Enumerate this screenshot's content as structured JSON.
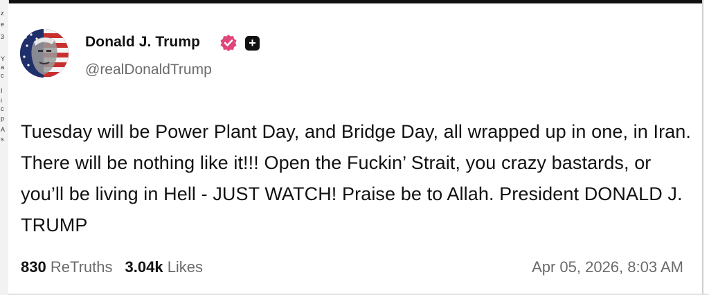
{
  "background_strip_text": [
    "z",
    "e",
    "3",
    "Y",
    "a",
    "c",
    "I",
    "i",
    "c",
    "p",
    "A",
    "s"
  ],
  "post": {
    "author": {
      "display_name": "Donald J. Trump",
      "handle": "@realDonaldTrump",
      "verified_icon": "verified-badge-icon",
      "plus_icon": "plus-icon",
      "plus_glyph": "+"
    },
    "text": "Tuesday will be Power Plant Day, and Bridge Day, all wrapped up in one, in Iran. There will be nothing like it!!! Open the Fuckin’ Strait, you crazy bastards, or you’ll be living in Hell - JUST WATCH! Praise be to Allah. President DONALD J. TRUMP",
    "stats": {
      "retruths_count": "830",
      "retruths_label": "ReTruths",
      "likes_count": "3.04k",
      "likes_label": "Likes"
    },
    "timestamp": "Apr 05, 2026, 8:03 AM"
  },
  "colors": {
    "verified_badge": "#e0457b",
    "text_primary": "#111111",
    "text_secondary": "#6b6b6b"
  }
}
